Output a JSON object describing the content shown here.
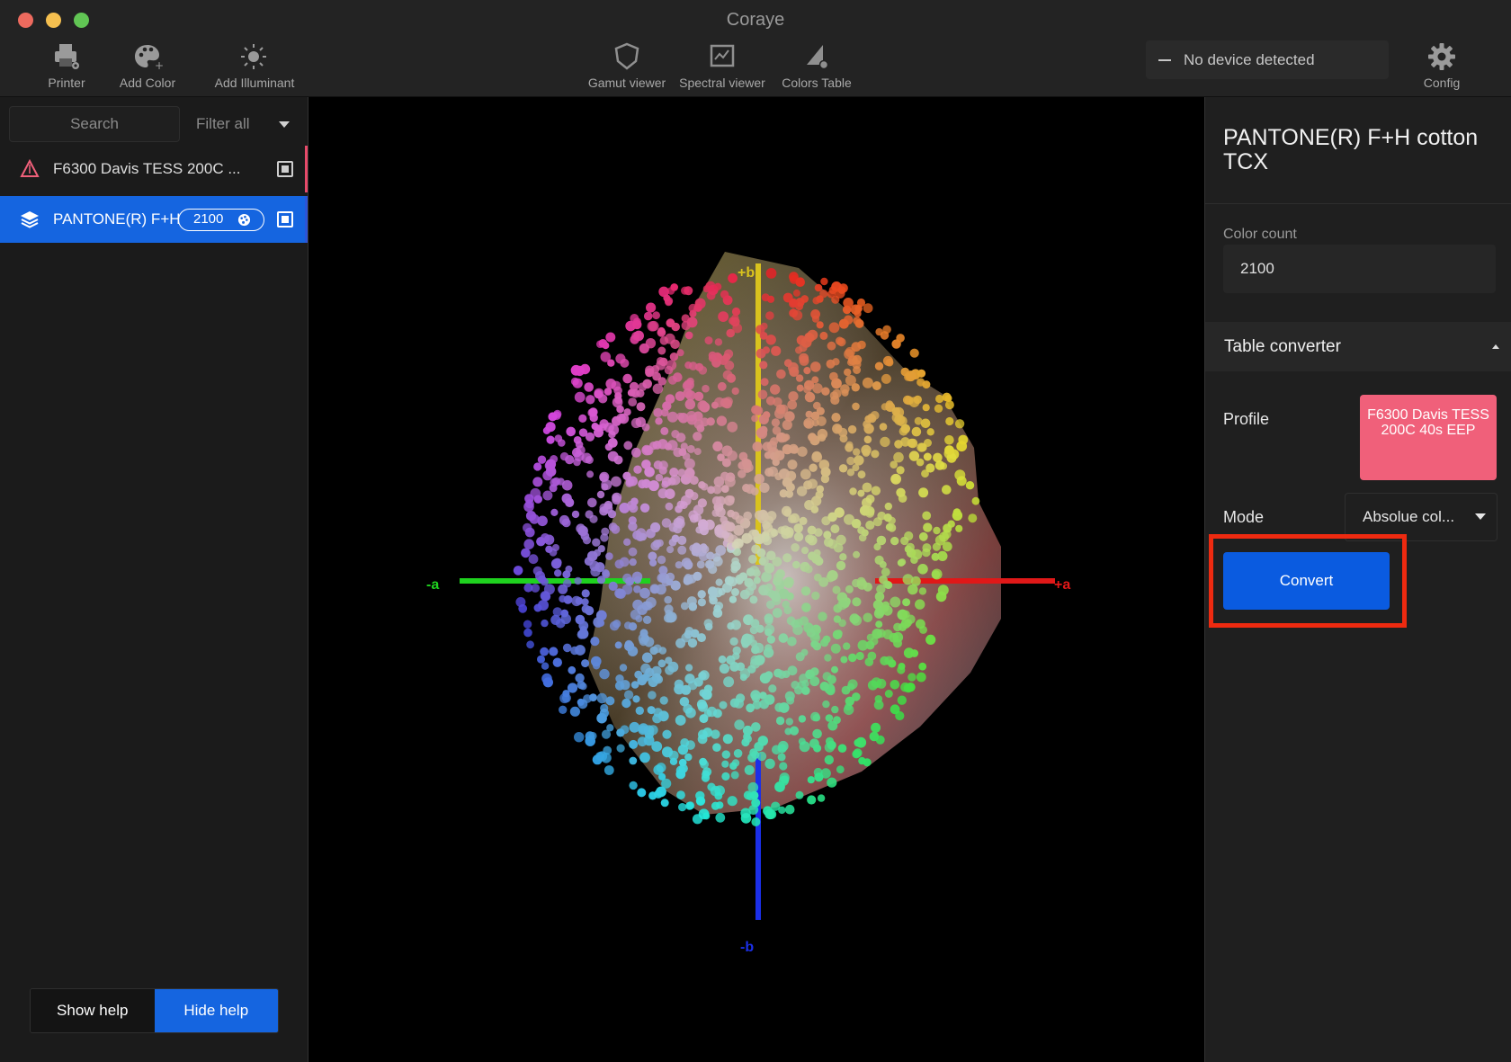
{
  "window": {
    "title": "Coraye",
    "traffic_lights": {
      "close": "#ed6a5e",
      "minimize": "#f5bf4f",
      "maximize": "#61c554"
    }
  },
  "toolbar": {
    "printer": "Printer",
    "add_color": "Add Color",
    "add_illuminant": "Add Illuminant",
    "gamut_viewer": "Gamut viewer",
    "spectral_viewer": "Spectral viewer",
    "colors_table": "Colors Table",
    "config": "Config",
    "device_status": "No device detected"
  },
  "sidebar": {
    "search_placeholder": "Search",
    "filter_label": "Filter all",
    "items": [
      {
        "label": "F6300 Davis TESS 200C ...",
        "icon": "warning-triangle-icon",
        "selected": false,
        "accent": "#e84a6a"
      },
      {
        "label": "PANTONE(R) F+H",
        "count": "2100",
        "icon": "layers-icon",
        "selected": true,
        "accent": "#1565e0"
      }
    ],
    "help": {
      "show": "Show help",
      "hide": "Hide help"
    }
  },
  "viewer": {
    "axis_labels": {
      "plus_b": "+b",
      "minus_b": "-b",
      "plus_a": "+a",
      "minus_a": "-a"
    },
    "axis_colors": {
      "b_plus": "#d9c21e",
      "b_minus": "#1b2fe8",
      "a_plus": "#e01818",
      "a_minus": "#1fd21f"
    }
  },
  "panel": {
    "title": "PANTONE(R) F+H cotton TCX",
    "color_count_label": "Color count",
    "color_count_value": "2100",
    "section_title": "Table converter",
    "profile_label": "Profile",
    "profile_value": "F6300 Davis TESS 200C 40s EEP",
    "mode_label": "Mode",
    "mode_value": "Absolue col...",
    "convert_label": "Convert",
    "accent_color": "#0a5be0",
    "profile_color": "#f0607a",
    "highlight_color": "#ee2a10"
  }
}
